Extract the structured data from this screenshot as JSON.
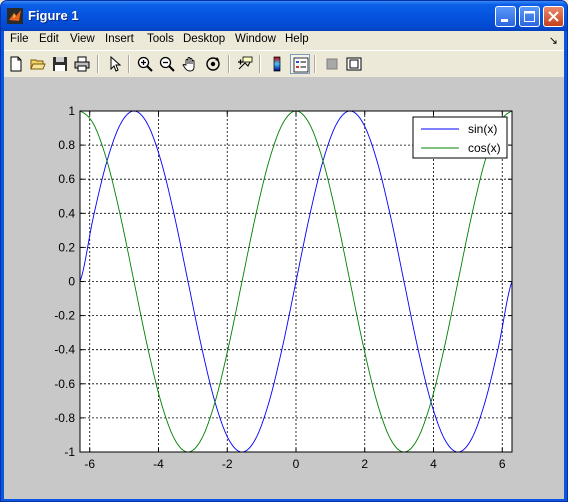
{
  "window": {
    "title": "Figure 1"
  },
  "menu": [
    "File",
    "Edit",
    "View",
    "Insert",
    "Tools",
    "Desktop",
    "Window",
    "Help"
  ],
  "dock_glyph": "↘",
  "toolbar": {
    "buttons": [
      "new-figure",
      "open-file",
      "save",
      "print",
      "edit-plot",
      "zoom-in",
      "zoom-out",
      "pan",
      "rotate-3d",
      "data-cursor",
      "colorbar",
      "legend",
      "hide-plot-tools",
      "show-plot-tools"
    ]
  },
  "colors": {
    "sin": "#0000ff",
    "cos": "#008000",
    "figure_bg": "#c8c8c8",
    "titlebar": "#0553e0"
  },
  "chart_data": {
    "type": "line",
    "title": "",
    "xlabel": "",
    "ylabel": "",
    "xlim": [
      -6.2832,
      6.2832
    ],
    "ylim": [
      -1,
      1
    ],
    "xticks": [
      -6,
      -4,
      -2,
      0,
      2,
      4,
      6
    ],
    "xtick_labels": [
      "-6",
      "-4",
      "-2",
      "0",
      "2",
      "4",
      "6"
    ],
    "yticks": [
      -1,
      -0.8,
      -0.6,
      -0.4,
      -0.2,
      0,
      0.2,
      0.4,
      0.6,
      0.8,
      1
    ],
    "ytick_labels": [
      "-1",
      "-0.8",
      "-0.6",
      "-0.4",
      "-0.2",
      "0",
      "0.2",
      "0.4",
      "0.6",
      "0.8",
      "1"
    ],
    "grid": true,
    "grid_style": "dashed",
    "legend_position": "top-right",
    "x": [
      -6.2832,
      -5.8905,
      -5.4978,
      -5.1051,
      -4.7124,
      -4.3197,
      -3.927,
      -3.5343,
      -3.1416,
      -2.7489,
      -2.3562,
      -1.9635,
      -1.5708,
      -1.1781,
      -0.7854,
      -0.3927,
      0,
      0.3927,
      0.7854,
      1.1781,
      1.5708,
      1.9635,
      2.3562,
      2.7489,
      3.1416,
      3.5343,
      3.927,
      4.3197,
      4.7124,
      5.1051,
      5.4978,
      5.8905,
      6.2832
    ],
    "series": [
      {
        "name": "sin(x)",
        "color": "#0000ff",
        "values": [
          0,
          0.3827,
          0.7071,
          0.9239,
          1,
          0.9239,
          0.7071,
          0.3827,
          0,
          -0.3827,
          -0.7071,
          -0.9239,
          -1,
          -0.9239,
          -0.7071,
          -0.3827,
          0,
          0.3827,
          0.7071,
          0.9239,
          1,
          0.9239,
          0.7071,
          0.3827,
          0,
          -0.3827,
          -0.7071,
          -0.9239,
          -1,
          -0.9239,
          -0.7071,
          -0.3827,
          0
        ]
      },
      {
        "name": "cos(x)",
        "color": "#008000",
        "values": [
          1,
          0.9239,
          0.7071,
          0.3827,
          0,
          -0.3827,
          -0.7071,
          -0.9239,
          -1,
          -0.9239,
          -0.7071,
          -0.3827,
          0,
          0.3827,
          0.7071,
          0.9239,
          1,
          0.9239,
          0.7071,
          0.3827,
          0,
          -0.3827,
          -0.7071,
          -0.9239,
          -1,
          -0.9239,
          -0.7071,
          -0.3827,
          0,
          0.3827,
          0.7071,
          0.9239,
          1
        ]
      }
    ]
  }
}
